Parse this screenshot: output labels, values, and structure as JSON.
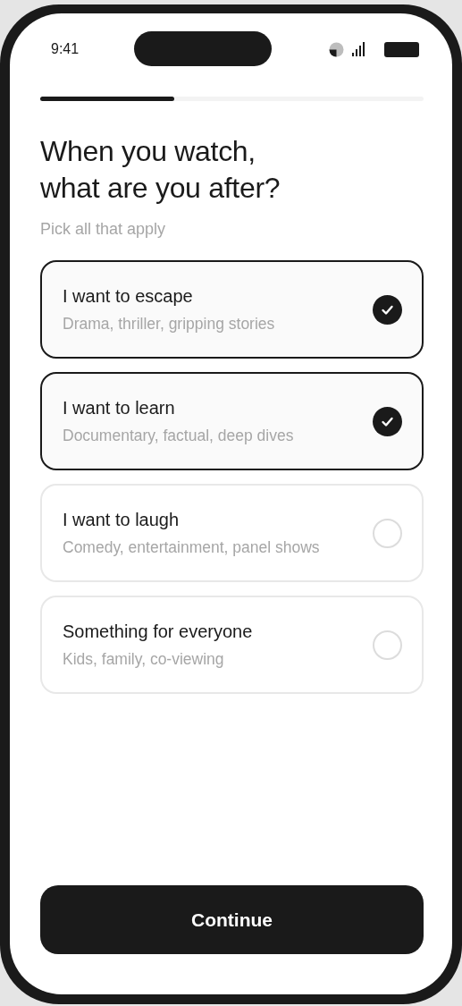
{
  "status_bar": {
    "time": "9:41"
  },
  "progress": {
    "level": 0.35
  },
  "heading": "When you watch,\nwhat are you after?",
  "subtitle": "Pick all that apply",
  "options": [
    {
      "title": "I want to escape",
      "description": "Drama, thriller, gripping stories",
      "selected": true
    },
    {
      "title": "I want to learn",
      "description": "Documentary, factual, deep dives",
      "selected": true
    },
    {
      "title": "I want to laugh",
      "description": "Comedy, entertainment, panel shows",
      "selected": false
    },
    {
      "title": "Something for everyone",
      "description": "Kids, family, co-viewing",
      "selected": false
    }
  ],
  "continue_button": "Continue"
}
